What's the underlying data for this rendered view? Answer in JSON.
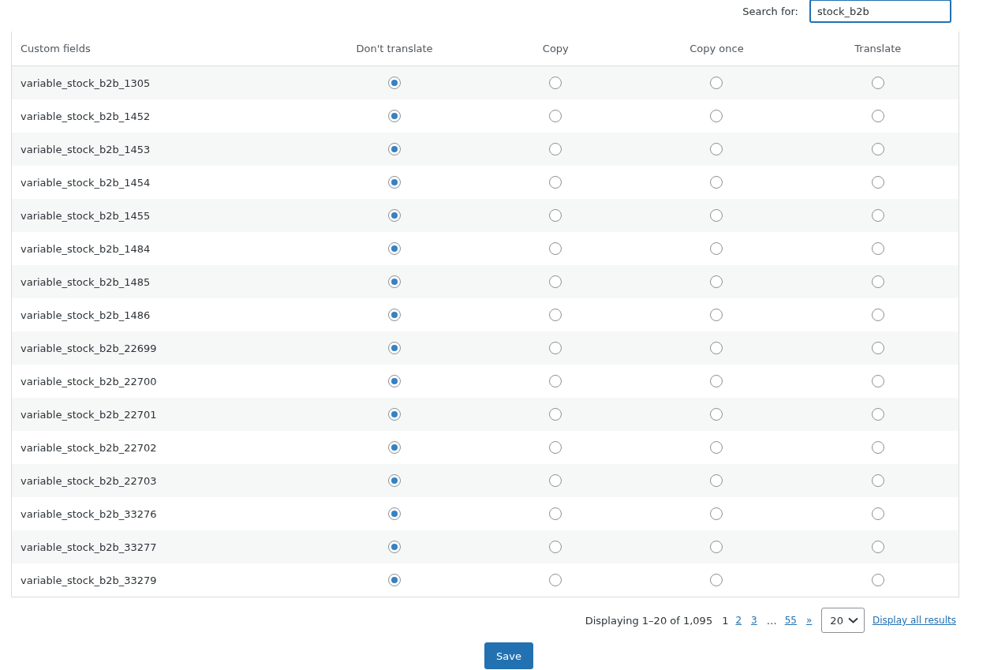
{
  "search": {
    "label": "Search for:",
    "value": "stock_b2b"
  },
  "table": {
    "columns": [
      "Custom fields",
      "Don't translate",
      "Copy",
      "Copy once",
      "Translate"
    ],
    "rows": [
      {
        "name": "variable_stock_b2b_1305",
        "options": [
          {
            "selected": true
          },
          {
            "selected": false
          },
          {
            "selected": false
          },
          {
            "selected": false
          }
        ]
      },
      {
        "name": "variable_stock_b2b_1452",
        "options": [
          {
            "selected": true
          },
          {
            "selected": false
          },
          {
            "selected": false
          },
          {
            "selected": false
          }
        ]
      },
      {
        "name": "variable_stock_b2b_1453",
        "options": [
          {
            "selected": true
          },
          {
            "selected": false
          },
          {
            "selected": false
          },
          {
            "selected": false
          }
        ]
      },
      {
        "name": "variable_stock_b2b_1454",
        "options": [
          {
            "selected": true
          },
          {
            "selected": false
          },
          {
            "selected": false
          },
          {
            "selected": false
          }
        ]
      },
      {
        "name": "variable_stock_b2b_1455",
        "options": [
          {
            "selected": true
          },
          {
            "selected": false
          },
          {
            "selected": false
          },
          {
            "selected": false
          }
        ]
      },
      {
        "name": "variable_stock_b2b_1484",
        "options": [
          {
            "selected": true
          },
          {
            "selected": false
          },
          {
            "selected": false
          },
          {
            "selected": false
          }
        ]
      },
      {
        "name": "variable_stock_b2b_1485",
        "options": [
          {
            "selected": true
          },
          {
            "selected": false
          },
          {
            "selected": false
          },
          {
            "selected": false
          }
        ]
      },
      {
        "name": "variable_stock_b2b_1486",
        "options": [
          {
            "selected": true
          },
          {
            "selected": false
          },
          {
            "selected": false
          },
          {
            "selected": false
          }
        ]
      },
      {
        "name": "variable_stock_b2b_22699",
        "options": [
          {
            "selected": true
          },
          {
            "selected": false
          },
          {
            "selected": false
          },
          {
            "selected": false
          }
        ]
      },
      {
        "name": "variable_stock_b2b_22700",
        "options": [
          {
            "selected": true
          },
          {
            "selected": false
          },
          {
            "selected": false
          },
          {
            "selected": false
          }
        ]
      },
      {
        "name": "variable_stock_b2b_22701",
        "options": [
          {
            "selected": true
          },
          {
            "selected": false
          },
          {
            "selected": false
          },
          {
            "selected": false
          }
        ]
      },
      {
        "name": "variable_stock_b2b_22702",
        "options": [
          {
            "selected": true
          },
          {
            "selected": false
          },
          {
            "selected": false
          },
          {
            "selected": false
          }
        ]
      },
      {
        "name": "variable_stock_b2b_22703",
        "options": [
          {
            "selected": true
          },
          {
            "selected": false
          },
          {
            "selected": false
          },
          {
            "selected": false
          }
        ]
      },
      {
        "name": "variable_stock_b2b_33276",
        "options": [
          {
            "selected": true
          },
          {
            "selected": false
          },
          {
            "selected": false
          },
          {
            "selected": false
          }
        ]
      },
      {
        "name": "variable_stock_b2b_33277",
        "options": [
          {
            "selected": true
          },
          {
            "selected": false
          },
          {
            "selected": false
          },
          {
            "selected": false
          }
        ]
      },
      {
        "name": "variable_stock_b2b_33279",
        "options": [
          {
            "selected": true
          },
          {
            "selected": false
          },
          {
            "selected": false
          },
          {
            "selected": false
          }
        ]
      }
    ]
  },
  "pagination": {
    "summary": "Displaying 1–20 of 1,095",
    "pages": [
      {
        "label": "1",
        "selected": true,
        "kind": "page"
      },
      {
        "label": "2",
        "selected": false,
        "kind": "page"
      },
      {
        "label": "3",
        "selected": false,
        "kind": "page"
      },
      {
        "label": "…",
        "kind": "gap"
      },
      {
        "label": "55",
        "selected": false,
        "kind": "page"
      },
      {
        "label": "»",
        "selected": false,
        "kind": "page"
      }
    ],
    "per_page": "20",
    "show_all": "Display all results"
  },
  "save_button": "Save"
}
